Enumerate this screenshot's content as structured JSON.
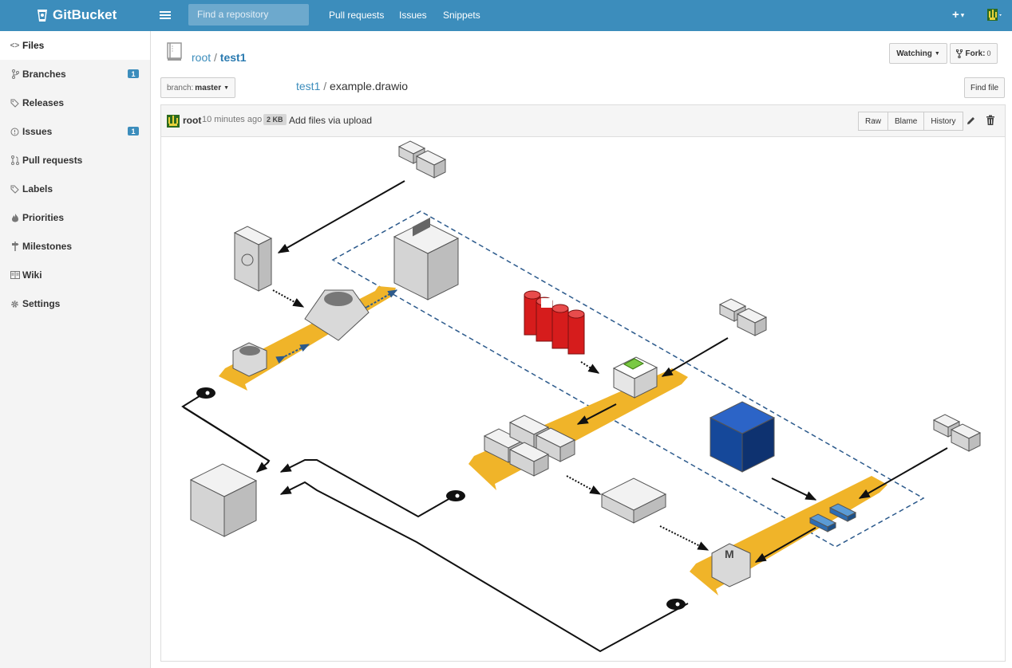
{
  "app": {
    "brand": "GitBucket"
  },
  "topbar": {
    "search_placeholder": "Find a repository",
    "nav": [
      "Pull requests",
      "Issues",
      "Snippets"
    ],
    "plus_label": "+"
  },
  "sidebar": {
    "items": [
      {
        "label": "Files",
        "icon": "code-icon",
        "active": true
      },
      {
        "label": "Branches",
        "icon": "branch-icon",
        "badge": "1"
      },
      {
        "label": "Releases",
        "icon": "tag-icon"
      },
      {
        "label": "Issues",
        "icon": "issue-icon",
        "badge": "1"
      },
      {
        "label": "Pull requests",
        "icon": "pull-request-icon"
      },
      {
        "label": "Labels",
        "icon": "tag-icon"
      },
      {
        "label": "Priorities",
        "icon": "flame-icon"
      },
      {
        "label": "Milestones",
        "icon": "milestone-icon"
      },
      {
        "label": "Wiki",
        "icon": "book-icon"
      },
      {
        "label": "Settings",
        "icon": "gear-icon"
      }
    ]
  },
  "repo": {
    "owner": "root",
    "separator": "/",
    "name": "test1",
    "watch_label": "Watching",
    "fork_label": "Fork:",
    "fork_count": "0"
  },
  "branch": {
    "prefix": "branch:",
    "name": "master"
  },
  "path": {
    "repo": "test1",
    "separator": "/",
    "file": "example.drawio"
  },
  "find_file_label": "Find file",
  "commit": {
    "user": "root",
    "time": "10 minutes ago",
    "size": "2 KB",
    "message": "Add files via upload"
  },
  "file_actions": [
    "Raw",
    "Blame",
    "History"
  ],
  "colors": {
    "accent": "#3c8dbc",
    "belt": "#f0b429",
    "red": "#d61c1c",
    "navy": "#15489a",
    "green": "#7ac943"
  }
}
